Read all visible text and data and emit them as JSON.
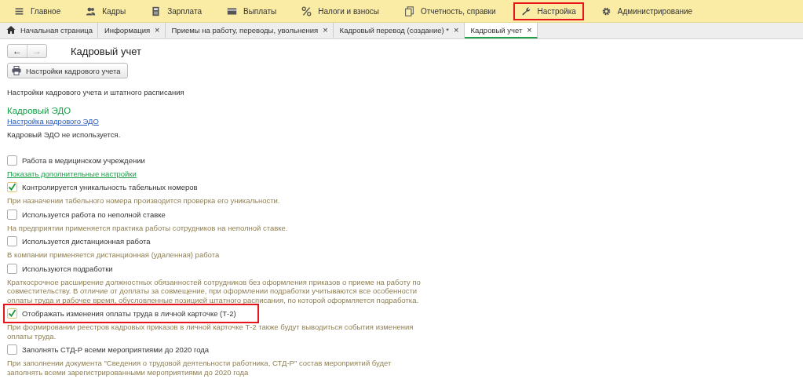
{
  "menu": [
    {
      "label": "Главное",
      "highlighted": false
    },
    {
      "label": "Кадры",
      "highlighted": false
    },
    {
      "label": "Зарплата",
      "highlighted": false
    },
    {
      "label": "Выплаты",
      "highlighted": false
    },
    {
      "label": "Налоги и взносы",
      "highlighted": false
    },
    {
      "label": "Отчетность, справки",
      "highlighted": false
    },
    {
      "label": "Настройка",
      "highlighted": true
    },
    {
      "label": "Администрирование",
      "highlighted": false
    }
  ],
  "close_glyph": "×",
  "nav": {
    "back": "←",
    "forward": "→"
  },
  "tabs": [
    {
      "label": "Начальная страница",
      "home": true,
      "selected": false
    },
    {
      "label": "Информация",
      "home": false,
      "selected": false
    },
    {
      "label": "Приемы на работу, переводы, увольнения",
      "home": false,
      "selected": false
    },
    {
      "label": "Кадровый перевод (создание) *",
      "home": false,
      "selected": false
    },
    {
      "label": "Кадровый учет",
      "home": false,
      "selected": true
    }
  ],
  "form": {
    "title": "Кадровый учет",
    "print_button": "Настройки кадрового учета",
    "intro": "Настройки кадрового учета и штатного расписания",
    "section_title": "Кадровый ЭДО",
    "section_link": "Настройка кадрового ЭДО",
    "section_status": "Кадровый ЭДО не используется."
  },
  "settings": [
    {
      "kind": "checkbox",
      "label": "Работа в медицинском учреждении",
      "checked": false,
      "highlighted": false
    },
    {
      "kind": "link",
      "label": "Показать дополнительные настройки"
    },
    {
      "kind": "checkbox",
      "label": "Контролируется уникальность табельных номеров",
      "checked": true,
      "highlighted": false
    },
    {
      "kind": "note",
      "label": "При назначении табельного номера производится проверка его уникальности."
    },
    {
      "kind": "checkbox",
      "label": "Используется работа по неполной ставке",
      "checked": false,
      "highlighted": false
    },
    {
      "kind": "note",
      "label": "На предприятии применяется практика работы сотрудников на неполной ставке."
    },
    {
      "kind": "checkbox",
      "label": "Используется дистанционная работа",
      "checked": false,
      "highlighted": false
    },
    {
      "kind": "note",
      "label": "В компании применяется дистанционная (удаленная) работа"
    },
    {
      "kind": "checkbox",
      "label": "Используются подработки",
      "checked": false,
      "highlighted": false
    },
    {
      "kind": "note",
      "label": "Краткосрочное расширение должностных обязанностей сотрудников без оформления приказов о приеме на работу по совместительству. В отличие от доплаты за совмещение, при оформлении подработки учитываются все особенности оплаты труда и рабочее время, обусловленные позицией штатного расписания, по которой оформляется подработка."
    },
    {
      "kind": "checkbox",
      "label": "Отображать изменения оплаты труда в личной карточке (Т-2)",
      "checked": true,
      "highlighted": true
    },
    {
      "kind": "note",
      "label": "При формировании реестров кадровых приказов в личной карточке Т-2 также будут выводиться события изменения оплаты труда."
    },
    {
      "kind": "checkbox",
      "label": "Заполнять СТД-Р всеми мероприятиями до 2020 года",
      "checked": false,
      "highlighted": false
    },
    {
      "kind": "note",
      "label": "При заполнении документа \"Сведения о трудовой деятельности работника, СТД-Р\" состав мероприятий будет заполнять всеми зарегистрированными мероприятиями до 2020 года"
    }
  ]
}
